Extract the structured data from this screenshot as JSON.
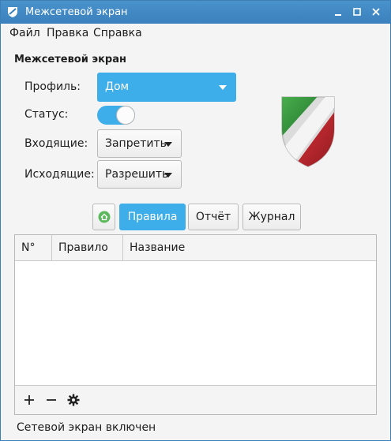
{
  "window": {
    "title": "Межсетевой экран"
  },
  "menu": {
    "file": "Файл",
    "edit": "Правка",
    "help": "Справка"
  },
  "section": {
    "title": "Межсетевой экран"
  },
  "fields": {
    "profile_label": "Профиль:",
    "profile_value": "Дом",
    "status_label": "Статус:",
    "status_on": true,
    "incoming_label": "Входящие:",
    "incoming_value": "Запретить",
    "outgoing_label": "Исходящие:",
    "outgoing_value": "Разрешить"
  },
  "tabs": [
    {
      "label": "Правила",
      "active": true
    },
    {
      "label": "Отчёт",
      "active": false
    },
    {
      "label": "Журнал",
      "active": false
    }
  ],
  "table": {
    "columns": [
      "N°",
      "Правило",
      "Название"
    ],
    "rows": []
  },
  "toolbar": {
    "icons": [
      "add-icon",
      "remove-icon",
      "settings-icon"
    ]
  },
  "status": {
    "text": "Сетевой экран включен"
  },
  "colors": {
    "accent": "#3daee9",
    "titlebar": "#3a81bd",
    "shield_green": "#2e8b3a",
    "shield_red": "#c0262d"
  }
}
